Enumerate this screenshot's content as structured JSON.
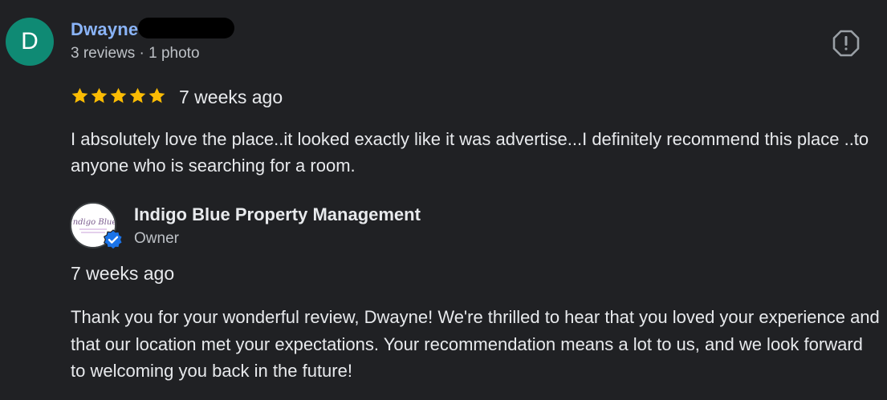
{
  "review": {
    "avatar_letter": "D",
    "reviewer_name": "Dwayne",
    "reviewer_meta": "3 reviews · 1 photo",
    "rating": 5,
    "time_ago": "7 weeks ago",
    "text": "I absolutely love the place..it looked exactly like it was advertise...I definitely recommend this place ..to anyone who is searching for a room."
  },
  "owner_response": {
    "name": "Indigo Blue Property Management",
    "role": "Owner",
    "time_ago": "7 weeks ago",
    "text": "Thank you for your wonderful review, Dwayne! We're thrilled to hear that you loved your experience and that our location met your expectations. Your recommendation means a lot to us, and we look forward to welcoming you back in the future!",
    "logo_text": "Indigo Blue"
  },
  "colors": {
    "background": "#202124",
    "avatar": "#0f8a74",
    "name_link": "#8ab4f8",
    "star": "#fbbc04",
    "verified": "#1a73e8"
  },
  "icons": {
    "report": "report-flag-icon",
    "star": "star-icon",
    "verified": "verified-check-icon"
  }
}
